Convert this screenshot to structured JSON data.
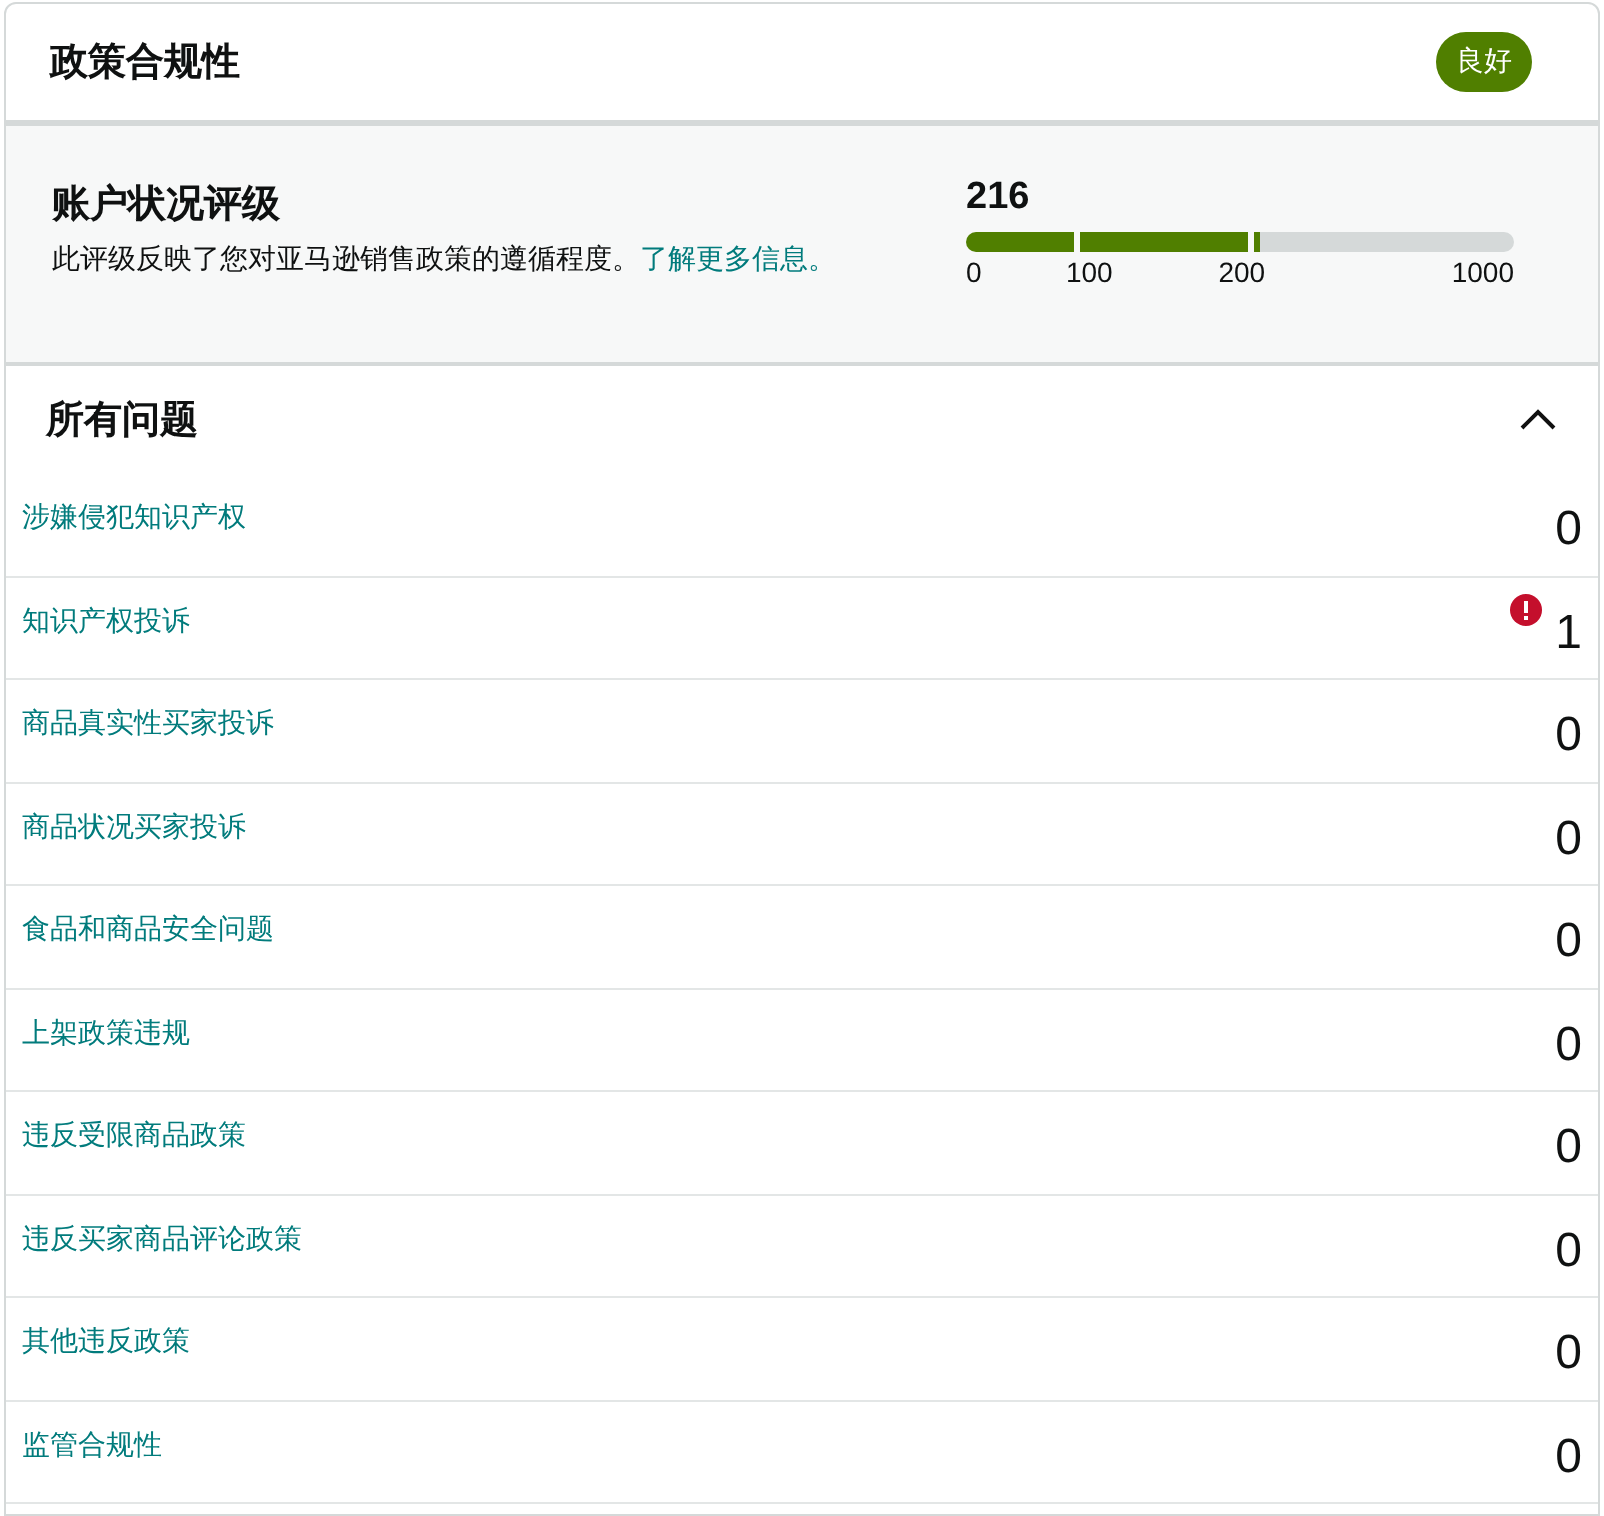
{
  "header": {
    "title": "政策合规性",
    "badge": "良好"
  },
  "rating": {
    "title": "账户状况评级",
    "description": "此评级反映了您对亚马逊销售政策的遵循程度。",
    "link": "了解更多信息。",
    "score": "216",
    "segments": [
      {
        "label": "0",
        "level": 1
      },
      {
        "label": "100",
        "level": 1
      },
      {
        "label": "200",
        "level": 0.02
      }
    ],
    "max_label": "1000"
  },
  "issues": {
    "title": "所有问题",
    "expanded": true,
    "rows": [
      {
        "label": "涉嫌侵犯知识产权",
        "count": "0",
        "alert": false
      },
      {
        "label": "知识产权投诉",
        "count": "1",
        "alert": true
      },
      {
        "label": "商品真实性买家投诉",
        "count": "0",
        "alert": false
      },
      {
        "label": "商品状况买家投诉",
        "count": "0",
        "alert": false
      },
      {
        "label": "食品和商品安全问题",
        "count": "0",
        "alert": false
      },
      {
        "label": "上架政策违规",
        "count": "0",
        "alert": false
      },
      {
        "label": "违反受限商品政策",
        "count": "0",
        "alert": false
      },
      {
        "label": "违反买家商品评论政策",
        "count": "0",
        "alert": false
      },
      {
        "label": "其他违反政策",
        "count": "0",
        "alert": false
      },
      {
        "label": "监管合规性",
        "count": "0",
        "alert": false
      }
    ]
  }
}
